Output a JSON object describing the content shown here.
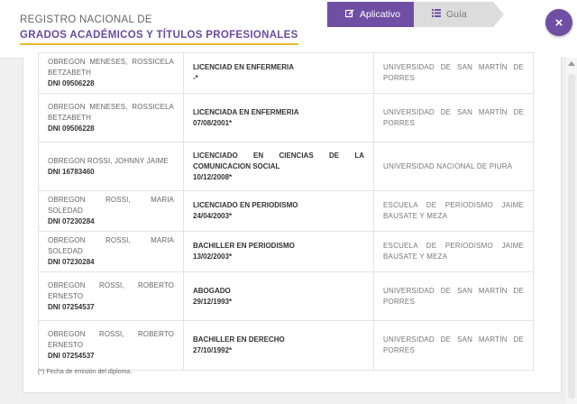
{
  "header": {
    "brand_top": "REGISTRO NACIONAL DE",
    "brand_main": "GRADOS ACADÉMICOS Y TÍTULOS PROFESIONALES",
    "tabs": [
      {
        "label": "Aplicativo",
        "icon": "edit-icon",
        "active": true
      },
      {
        "label": "Guía",
        "icon": "list-icon",
        "active": false
      }
    ],
    "close_label": "×"
  },
  "results": [
    {
      "name": "OBREGON MENESES, ROSSICELA BETZABETH",
      "dni": "DNI 09506228",
      "degree": "LICENCIAD EN ENFERMERIA",
      "date": "-*",
      "university": "UNIVERSIDAD DE SAN MARTÍN DE PORRES"
    },
    {
      "name": "OBREGON MENESES, ROSSICELA BETZABETH",
      "dni": "DNI 09506228",
      "degree": "LICENCIADA EN ENFERMERIA",
      "date": "07/08/2001*",
      "university": "UNIVERSIDAD DE SAN MARTÍN DE PORRES"
    },
    {
      "name": "OBREGON ROSSI, JOHNNY JAIME",
      "dni": "DNI 16783460",
      "degree": "LICENCIADO EN CIENCIAS DE LA COMUNICACION SOCIAL",
      "date": "10/12/2008*",
      "university": "UNIVERSIDAD NACIONAL DE PIURA"
    },
    {
      "name": "OBREGON ROSSI, MARIA SOLEDAD",
      "dni": "DNI 07230284",
      "degree": "LICENCIADO EN PERIODISMO",
      "date": "24/04/2003*",
      "university": "ESCUELA DE PERIODISMO JAIME BAUSATE Y MEZA"
    },
    {
      "name": "OBREGON ROSSI, MARIA SOLEDAD",
      "dni": "DNI 07230284",
      "degree": "BACHILLER EN PERIODISMO",
      "date": "13/02/2003*",
      "university": "ESCUELA DE PERIODISMO JAIME BAUSATE Y MEZA"
    },
    {
      "name": "OBREGON ROSSI, ROBERTO ERNESTO",
      "dni": "DNI 07254537",
      "degree": "ABOGADO",
      "date": "29/12/1993*",
      "university": "UNIVERSIDAD DE SAN MARTÍN DE PORRES"
    },
    {
      "name": "OBREGON ROSSI, ROBERTO ERNESTO",
      "dni": "DNI 07254537",
      "degree": "BACHILLER EN DERECHO",
      "date": "27/10/1992*",
      "university": "UNIVERSIDAD DE SAN MARTÍN DE PORRES"
    }
  ],
  "footnote": "(*) Fecha de emisión del diploma.",
  "colors": {
    "accent": "#6f4fa3",
    "underline": "#e8b92f",
    "tab_inactive": "#dcdcdc"
  }
}
